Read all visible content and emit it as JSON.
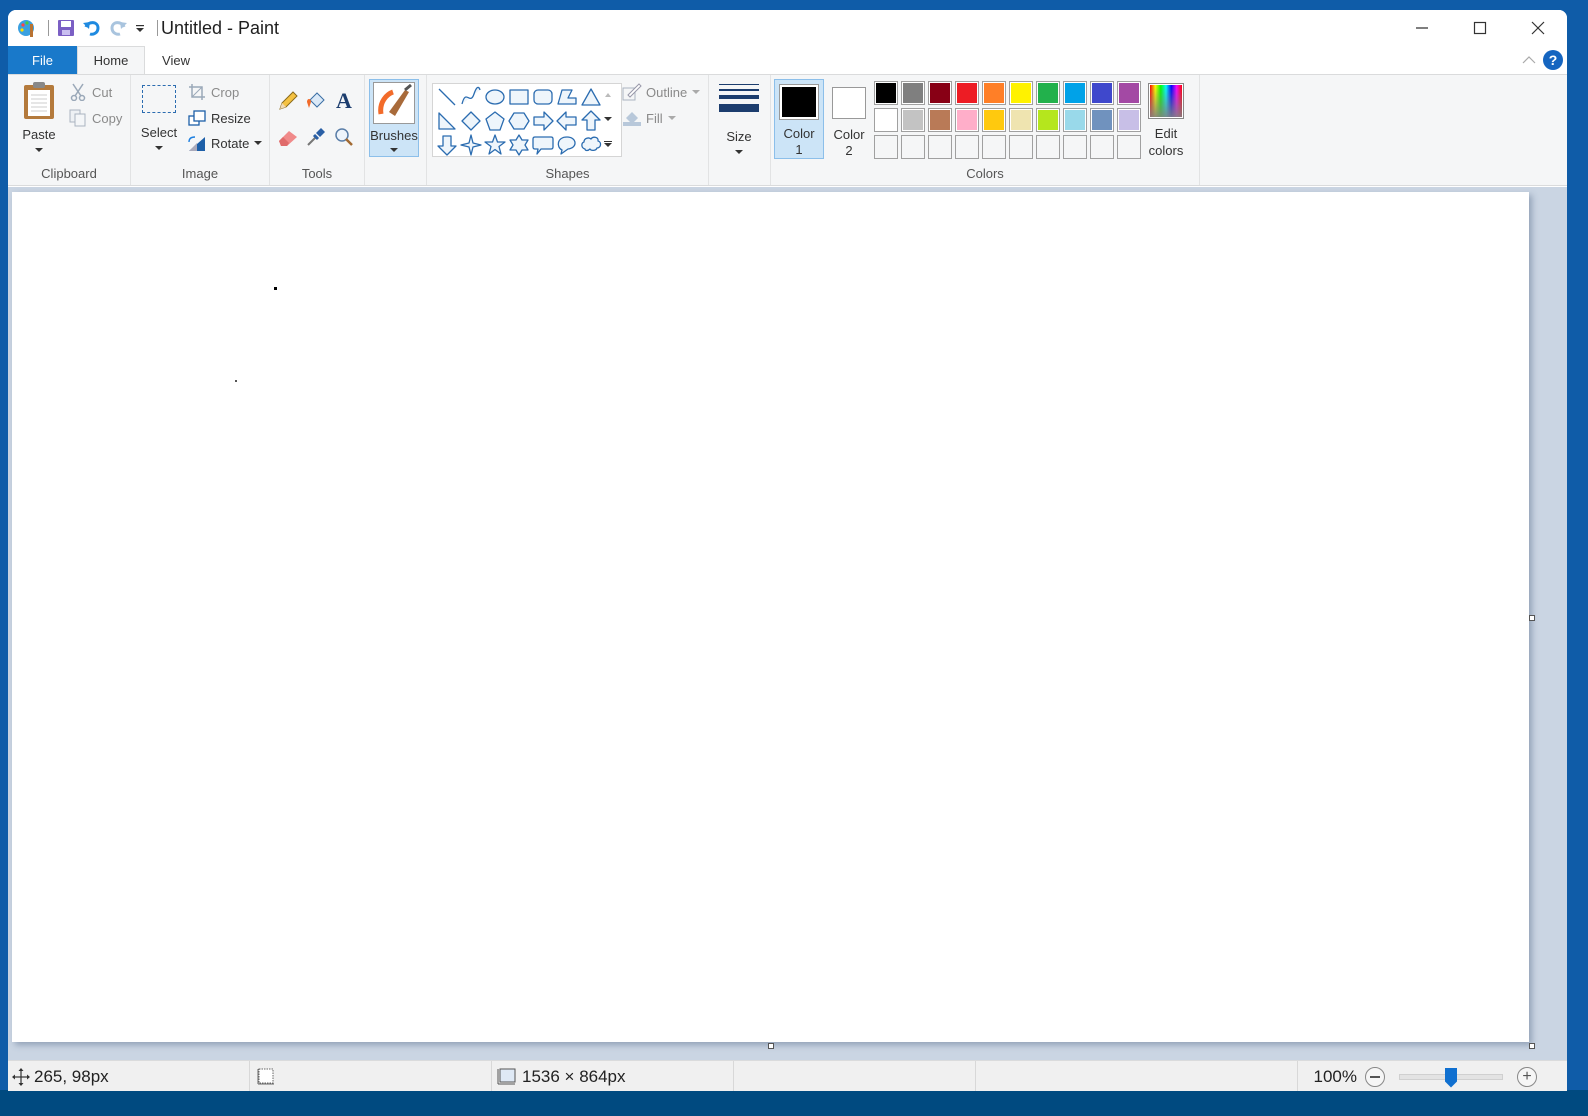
{
  "window": {
    "title": "Untitled - Paint",
    "quick_access": [
      {
        "name": "app-icon"
      },
      {
        "name": "save-icon"
      },
      {
        "name": "undo-icon"
      },
      {
        "name": "redo-icon"
      },
      {
        "name": "customize-qat-icon"
      }
    ],
    "controls": [
      "minimize",
      "maximize",
      "close"
    ]
  },
  "tabs": [
    {
      "label": "File",
      "active": false
    },
    {
      "label": "Home",
      "active": true
    },
    {
      "label": "View",
      "active": false
    }
  ],
  "ribbon": {
    "clipboard": {
      "label": "Clipboard",
      "paste": "Paste",
      "cut": "Cut",
      "copy": "Copy"
    },
    "image": {
      "label": "Image",
      "select": "Select",
      "crop": "Crop",
      "resize": "Resize",
      "rotate": "Rotate"
    },
    "tools": {
      "label": "Tools",
      "items": [
        "pencil",
        "fill-bucket",
        "text",
        "eraser",
        "color-picker",
        "magnifier"
      ]
    },
    "brushes": {
      "label": "Brushes"
    },
    "shapes": {
      "label": "Shapes",
      "items": [
        "line",
        "curve",
        "oval",
        "rectangle",
        "rounded-rectangle",
        "polygon",
        "triangle",
        "right-triangle",
        "diamond",
        "pentagon",
        "hexagon",
        "right-arrow",
        "left-arrow",
        "up-arrow",
        "down-arrow",
        "four-point-star",
        "five-point-star",
        "six-point-star",
        "rounded-callout",
        "oval-callout",
        "cloud-callout"
      ],
      "outline": "Outline",
      "fill": "Fill"
    },
    "size": {
      "label": "Size"
    },
    "colors": {
      "label": "Colors",
      "color1_label": "Color",
      "color1_num": "1",
      "color1_value": "#000000",
      "color2_label": "Color",
      "color2_num": "2",
      "color2_value": "#ffffff",
      "edit_line1": "Edit",
      "edit_line2": "colors",
      "palette_row1": [
        "#000000",
        "#7f7f7f",
        "#880015",
        "#ed1c24",
        "#ff7f27",
        "#fff200",
        "#22b14c",
        "#00a2e8",
        "#3f48cc",
        "#a349a4"
      ],
      "palette_row2": [
        "#ffffff",
        "#c3c3c3",
        "#b97a57",
        "#ffaec9",
        "#ffc90e",
        "#efe4b0",
        "#b5e61d",
        "#99d9ea",
        "#7092be",
        "#c8bfe7"
      ],
      "palette_row3_count": 10
    }
  },
  "canvas": {
    "background": "#ffffff"
  },
  "statusbar": {
    "cursor_position": "265, 98px",
    "canvas_size": "1536 × 864px",
    "zoom_level": "100%",
    "zoom_slider_fraction": 0.5
  }
}
